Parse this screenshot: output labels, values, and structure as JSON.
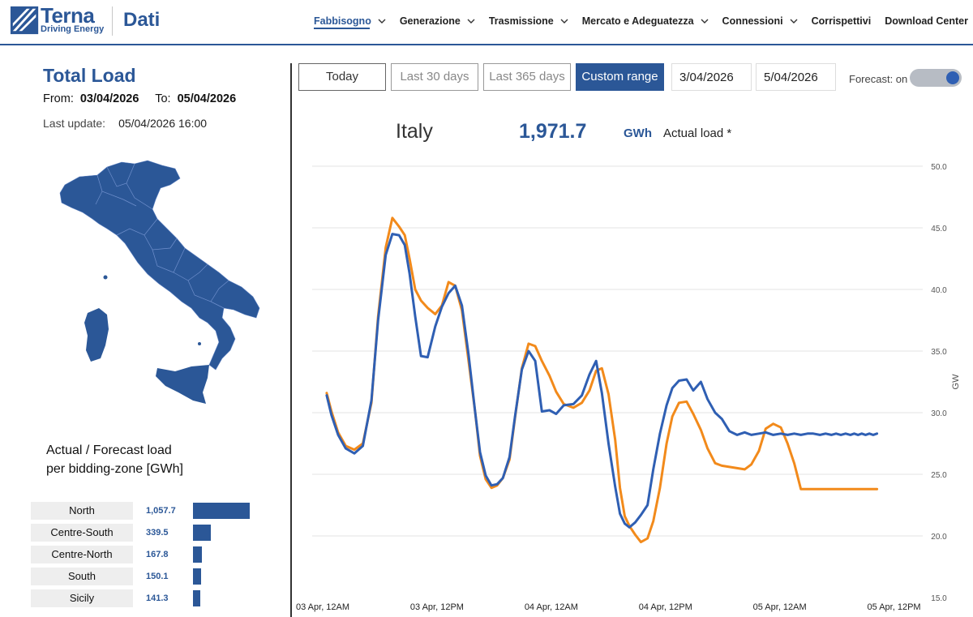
{
  "header": {
    "brand": "Terna",
    "brand_sub": "Driving Energy",
    "product": "Dati",
    "nav": [
      {
        "label": "Fabbisogno",
        "dropdown": true,
        "active": true
      },
      {
        "label": "Generazione",
        "dropdown": true
      },
      {
        "label": "Trasmissione",
        "dropdown": true
      },
      {
        "label": "Mercato e Adeguatezza",
        "dropdown": true
      },
      {
        "label": "Connessioni",
        "dropdown": true
      },
      {
        "label": "Corrispettivi",
        "dropdown": false
      },
      {
        "label": "Download Center",
        "dropdown": false
      }
    ]
  },
  "left": {
    "title": "Total Load",
    "from_label": "From:",
    "from_value": "03/04/2026",
    "to_label": "To:",
    "to_value": "05/04/2026",
    "update_label": "Last  update:",
    "update_value": "05/04/2026 16:00",
    "subtitle_line1": "Actual / Forecast load",
    "subtitle_line2": "per bidding-zone [GWh]",
    "zones": [
      {
        "name": "North",
        "value": "1,057.7",
        "amount": 1057.7
      },
      {
        "name": "Centre-South",
        "value": "339.5",
        "amount": 339.5
      },
      {
        "name": "Centre-North",
        "value": "167.8",
        "amount": 167.8
      },
      {
        "name": "South",
        "value": "150.1",
        "amount": 150.1
      },
      {
        "name": "Sicily",
        "value": "141.3",
        "amount": 141.3
      }
    ]
  },
  "controls": {
    "today": "Today",
    "last30": "Last 30 days",
    "last365": "Last 365 days",
    "custom": "Custom range",
    "date_from": "3/04/2026",
    "date_to": "5/04/2026",
    "forecast_label": "Forecast: on"
  },
  "summary": {
    "region": "Italy",
    "total": "1,971.7",
    "unit": "GWh",
    "label": "Actual load *"
  },
  "colors": {
    "brand": "#2b5797",
    "actual": "#2f5fb3",
    "forecast": "#f28a1b"
  },
  "chart_data": {
    "type": "line",
    "ylabel": "GW",
    "ylim": [
      15,
      50
    ],
    "yticks": [
      "15.0",
      "20.0",
      "25.0",
      "30.0",
      "35.0",
      "40.0",
      "45.0",
      "50.0"
    ],
    "xlim_hours": [
      0,
      66
    ],
    "xticks": [
      {
        "h": 0,
        "label": "03 Apr, 12AM"
      },
      {
        "h": 12,
        "label": "03 Apr, 12PM"
      },
      {
        "h": 24,
        "label": "04 Apr, 12AM"
      },
      {
        "h": 36,
        "label": "04 Apr, 12PM"
      },
      {
        "h": 48,
        "label": "05 Apr, 12AM"
      },
      {
        "h": 60,
        "label": "05 Apr, 12PM"
      }
    ],
    "grid": true,
    "series": [
      {
        "name": "Actual",
        "x": [
          3.4,
          3.9,
          4.6,
          5.4,
          6.3,
          7.2,
          8.1,
          8.8,
          9.6,
          10.3,
          11,
          11.6,
          12.1,
          12.7,
          13.3,
          14,
          14.8,
          15.5,
          16.2,
          16.9,
          17.6,
          18.3,
          19,
          19.5,
          20.1,
          20.7,
          21.3,
          21.9,
          22.6,
          23.2,
          23.9,
          24.6,
          25.3,
          26,
          26.8,
          27.5,
          28.3,
          29.3,
          30.2,
          31,
          31.7,
          32.3,
          33,
          33.7,
          34.2,
          34.7,
          35.2,
          35.8,
          36.4,
          37.1,
          37.7,
          38.4,
          39.1,
          39.7,
          40.4,
          41.2,
          41.9,
          42.7,
          43.4,
          44.2,
          44.9,
          45.7,
          46.5,
          47.3,
          48,
          48.8,
          49.5,
          50.3,
          51.1,
          51.8,
          52.5,
          53.2,
          53.9,
          54.5,
          55.2,
          55.8,
          56.4,
          56.9,
          57.4,
          57.9,
          58.4,
          58.8,
          59.2,
          59.6,
          60,
          60.4,
          60.8,
          61.2
        ],
        "y": [
          31.4,
          29.8,
          28.2,
          27.1,
          26.7,
          27.3,
          31,
          37.5,
          42.8,
          44.5,
          44.4,
          43.6,
          41.3,
          37.8,
          34.6,
          34.5,
          37,
          38.6,
          39.7,
          40.3,
          38.7,
          34.7,
          30,
          26.8,
          24.9,
          24.1,
          24.2,
          24.7,
          26.4,
          29.8,
          33.5,
          35,
          34.2,
          30.1,
          30.2,
          29.9,
          30.6,
          30.7,
          31.4,
          33.1,
          34.2,
          31.6,
          27.5,
          24,
          21.8,
          21,
          20.7,
          21.1,
          21.7,
          22.5,
          25.4,
          28.3,
          30.6,
          32,
          32.6,
          32.7,
          31.8,
          32.5,
          31.1,
          30,
          29.5,
          28.5,
          28.2,
          28.4,
          28.2,
          28.3,
          28.4,
          28.2,
          28.3,
          28.2,
          28.3,
          28.2,
          28.3,
          28.3,
          28.2,
          28.3,
          28.2,
          28.3,
          28.2,
          28.3,
          28.2,
          28.3,
          28.2,
          28.3,
          28.2,
          28.3,
          28.2,
          28.3
        ]
      },
      {
        "name": "Forecast",
        "x": [
          3.4,
          3.9,
          4.6,
          5.4,
          6.3,
          7.2,
          8.1,
          8.8,
          9.6,
          10.3,
          11,
          11.6,
          12.1,
          12.7,
          13.3,
          14,
          14.8,
          15.5,
          16.2,
          16.9,
          17.6,
          18.3,
          19,
          19.5,
          20.1,
          20.7,
          21.3,
          21.9,
          22.6,
          23.2,
          23.9,
          24.6,
          25.3,
          26,
          26.8,
          27.5,
          28.3,
          29.3,
          30.2,
          31,
          31.7,
          32.3,
          33,
          33.7,
          34.2,
          34.7,
          35.2,
          35.8,
          36.4,
          37.1,
          37.7,
          38.4,
          39.1,
          39.7,
          40.4,
          41.2,
          41.9,
          42.7,
          43.4,
          44.2,
          44.9,
          45.7,
          46.5,
          47.3,
          48,
          48.8,
          49.5,
          50.3,
          51.1,
          51.8,
          52.5,
          53.2,
          53.9,
          54.5,
          55.2,
          55.8,
          56.4,
          56.9,
          57.4,
          57.9,
          58.4,
          58.8,
          59.2,
          59.6,
          60,
          60.4,
          60.8,
          61.2
        ],
        "y": [
          31.6,
          30.1,
          28.4,
          27.3,
          27,
          27.5,
          30.8,
          37.8,
          43.4,
          45.8,
          45.1,
          44.4,
          42.5,
          40,
          39.1,
          38.5,
          38,
          38.7,
          40.6,
          40.3,
          38.3,
          34.2,
          30,
          26.5,
          24.6,
          23.9,
          24.1,
          24.7,
          26.2,
          29.7,
          33.6,
          35.6,
          35.4,
          34.2,
          33,
          31.7,
          30.7,
          30.4,
          30.8,
          31.8,
          33.4,
          33.6,
          31.5,
          27.8,
          23.9,
          21.6,
          20.8,
          20.1,
          19.5,
          19.8,
          21.2,
          23.9,
          27.5,
          29.7,
          30.8,
          30.9,
          29.9,
          28.6,
          27.1,
          25.9,
          25.7,
          25.6,
          25.5,
          25.4,
          25.8,
          26.9,
          28.7,
          29.1,
          28.8,
          27.5,
          25.9,
          23.8,
          23.8,
          23.8,
          23.8,
          23.8,
          23.8,
          23.8,
          23.8,
          23.8,
          23.8,
          23.8,
          23.8,
          23.8,
          23.8,
          23.8,
          23.8,
          23.8
        ]
      }
    ]
  }
}
